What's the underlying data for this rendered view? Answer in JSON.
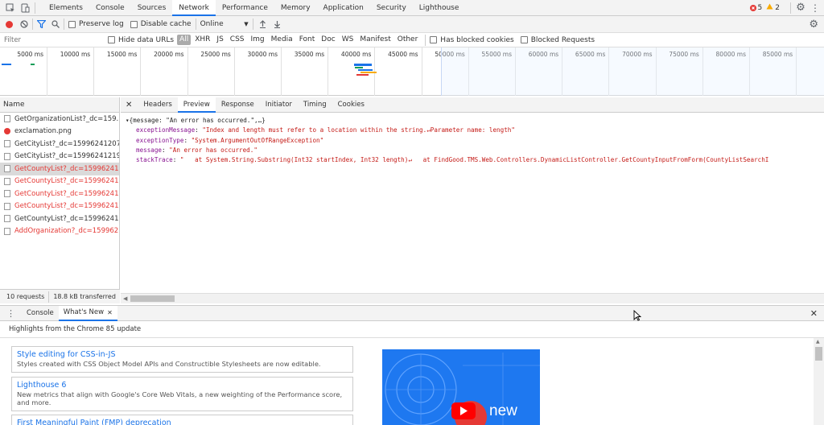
{
  "tabs": [
    "Elements",
    "Console",
    "Sources",
    "Network",
    "Performance",
    "Memory",
    "Application",
    "Security",
    "Lighthouse"
  ],
  "active_tab": "Network",
  "status": {
    "errors": "5",
    "warnings": "2"
  },
  "toolbar": {
    "preserve_log": "Preserve log",
    "disable_cache": "Disable cache",
    "throttle": "Online"
  },
  "filter": {
    "placeholder": "Filter",
    "hide_data_urls": "Hide data URLs",
    "types": [
      "All",
      "XHR",
      "JS",
      "CSS",
      "Img",
      "Media",
      "Font",
      "Doc",
      "WS",
      "Manifest",
      "Other"
    ],
    "active_type": "All",
    "has_blocked_cookies": "Has blocked cookies",
    "blocked_requests": "Blocked Requests"
  },
  "timeline_labels": [
    "5000 ms",
    "10000 ms",
    "15000 ms",
    "20000 ms",
    "25000 ms",
    "30000 ms",
    "35000 ms",
    "40000 ms",
    "45000 ms",
    "50000 ms",
    "55000 ms",
    "60000 ms",
    "65000 ms",
    "70000 ms",
    "75000 ms",
    "80000 ms",
    "85000 ms"
  ],
  "requests": {
    "header": "Name",
    "items": [
      {
        "name": "GetOrganizationList?_dc=159...",
        "type": "xhr",
        "status": "ok"
      },
      {
        "name": "exclamation.png",
        "type": "img",
        "status": "ok"
      },
      {
        "name": "GetCityList?_dc=15996241207...",
        "type": "xhr",
        "status": "ok"
      },
      {
        "name": "GetCityList?_dc=15996241219...",
        "type": "xhr",
        "status": "ok"
      },
      {
        "name": "GetCountyList?_dc=15996241...",
        "type": "xhr",
        "status": "error",
        "selected": true
      },
      {
        "name": "GetCountyList?_dc=15996241...",
        "type": "xhr",
        "status": "error"
      },
      {
        "name": "GetCountyList?_dc=15996241...",
        "type": "xhr",
        "status": "error"
      },
      {
        "name": "GetCountyList?_dc=15996241...",
        "type": "xhr",
        "status": "error"
      },
      {
        "name": "GetCountyList?_dc=15996241...",
        "type": "xhr",
        "status": "ok"
      },
      {
        "name": "AddOrganization?_dc=159962...",
        "type": "xhr",
        "status": "error"
      }
    ],
    "footer_count": "10 requests",
    "footer_size": "18.8 kB transferred"
  },
  "detail": {
    "tabs": [
      "Headers",
      "Preview",
      "Response",
      "Initiator",
      "Timing",
      "Cookies"
    ],
    "active": "Preview",
    "preview_summary": "{message: \"An error has occurred.\",…}",
    "fields": [
      {
        "key": "exceptionMessage",
        "value": "\"Index and length must refer to a location within the string.↵Parameter name: length\""
      },
      {
        "key": "exceptionType",
        "value": "\"System.ArgumentOutOfRangeException\""
      },
      {
        "key": "message",
        "value": "\"An error has occurred.\""
      },
      {
        "key": "stackTrace",
        "value": "\"   at System.String.Substring(Int32 startIndex, Int32 length)↵   at FindGood.TMS.Web.Controllers.DynamicListController.GetCountyInputFromForm(CountyListSearchI"
      }
    ]
  },
  "drawer": {
    "tabs": [
      "Console",
      "What's New"
    ],
    "active": "What's New",
    "highlights": "Highlights from the Chrome 85 update",
    "cards": [
      {
        "title": "Style editing for CSS-in-JS",
        "desc": "Styles created with CSS Object Model APIs and Constructible Stylesheets are now editable."
      },
      {
        "title": "Lighthouse 6",
        "desc": "New metrics that align with Google's Core Web Vitals, a new weighting of the Performance score, and more."
      },
      {
        "title": "First Meaningful Paint (FMP) deprecation",
        "desc": ""
      }
    ],
    "promo_text": "new"
  },
  "colors": {
    "accent": "#1a73e8",
    "error": "#e53935",
    "warning": "#f9ab00",
    "promo": "#1e78f0"
  }
}
